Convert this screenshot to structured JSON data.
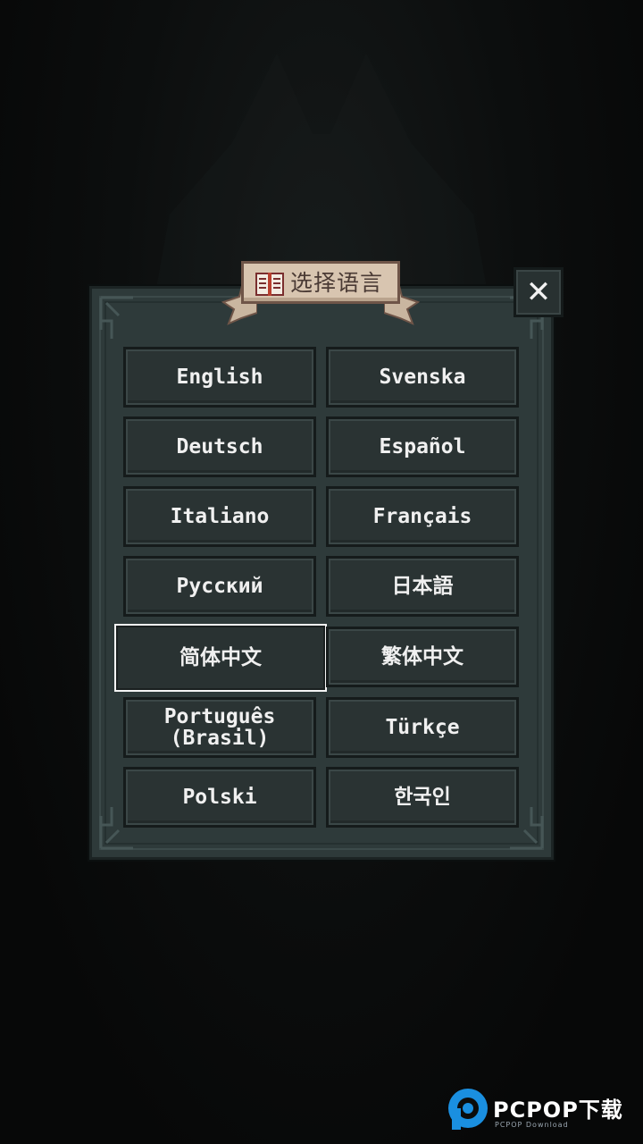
{
  "dialog": {
    "title": "选择语言",
    "close_label": "✕"
  },
  "languages": [
    {
      "label": "English",
      "selected": false
    },
    {
      "label": "Svenska",
      "selected": false
    },
    {
      "label": "Deutsch",
      "selected": false
    },
    {
      "label": "Español",
      "selected": false
    },
    {
      "label": "Italiano",
      "selected": false
    },
    {
      "label": "Français",
      "selected": false
    },
    {
      "label": "Русский",
      "selected": false
    },
    {
      "label": "日本語",
      "selected": false
    },
    {
      "label": "简体中文",
      "selected": true
    },
    {
      "label": "繁体中文",
      "selected": false
    },
    {
      "label": "Português\n(Brasil)",
      "selected": false
    },
    {
      "label": "Türkçe",
      "selected": false
    },
    {
      "label": "Polski",
      "selected": false
    },
    {
      "label": "한국인",
      "selected": false
    }
  ],
  "watermark": {
    "brand": "PCPOP下载",
    "subtitle": "PCPOP Download"
  },
  "colors": {
    "panel": "#2e3a3a",
    "button": "#2a3333",
    "selected_border": "#f4f4f4",
    "banner": "#d8c5b0",
    "background": "#080909"
  }
}
